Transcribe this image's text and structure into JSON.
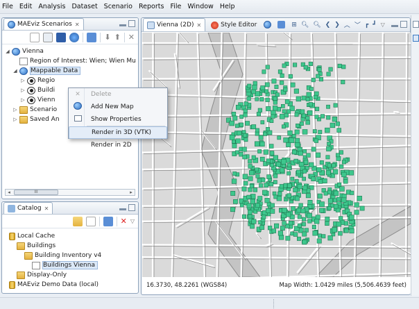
{
  "menu": [
    "File",
    "Edit",
    "Analysis",
    "Dataset",
    "Scenario",
    "Reports",
    "File",
    "Window",
    "Help"
  ],
  "scenarios_panel": {
    "tab_label": "MAEviz Scenarios",
    "tree": [
      {
        "label": "Vienna",
        "icon": "globe-icon",
        "indent": 0,
        "twisty": "◢"
      },
      {
        "label": "Region of Interest: Wien; Wien Mu",
        "icon": "document-icon",
        "indent": 1,
        "twisty": ""
      },
      {
        "label": "Mappable Data",
        "icon": "globe-icon",
        "indent": 1,
        "twisty": "◢",
        "selected": true
      },
      {
        "label": "Regio",
        "icon": "eye-icon",
        "indent": 2,
        "twisty": "▷"
      },
      {
        "label": "Buildi",
        "icon": "eye-icon",
        "indent": 2,
        "twisty": "▷"
      },
      {
        "label": "Vienn",
        "icon": "eye-icon",
        "indent": 2,
        "twisty": "▷"
      },
      {
        "label": "Scenario",
        "icon": "folder-icon",
        "indent": 1,
        "twisty": "▷"
      },
      {
        "label": "Saved An",
        "icon": "folder-icon",
        "indent": 1,
        "twisty": "▷"
      }
    ],
    "scroll_thumb": "III"
  },
  "context_menu": [
    {
      "label": "Delete",
      "icon": "delete-icon",
      "disabled": true
    },
    {
      "label": "Add New Map",
      "icon": "globe-icon",
      "disabled": false
    },
    {
      "label": "Show Properties",
      "icon": "properties-icon",
      "disabled": false
    },
    {
      "label": "Render in 3D (VTK)",
      "icon": "",
      "disabled": false,
      "highlighted": true
    },
    {
      "label": "Render in 2D",
      "icon": "",
      "disabled": false
    }
  ],
  "catalog_panel": {
    "tab_label": "Catalog",
    "tree": [
      {
        "label": "Local Cache",
        "icon": "database-icon",
        "indent": 0
      },
      {
        "label": "Buildings",
        "icon": "folder-icon",
        "indent": 1
      },
      {
        "label": "Building Inventory v4",
        "icon": "folder-icon",
        "indent": 2
      },
      {
        "label": "Buildings Vienna",
        "icon": "document-icon",
        "indent": 3,
        "selected": true
      },
      {
        "label": "Display-Only",
        "icon": "folder-icon",
        "indent": 1
      },
      {
        "label": "MAEviz Demo Data (local)",
        "icon": "database-icon",
        "indent": 0
      }
    ]
  },
  "map_panel": {
    "tabs": [
      {
        "label": "Vienna (2D)",
        "closable": true
      },
      {
        "label": "Style Editor",
        "closable": false
      }
    ],
    "coordinates": "16.3730, 48.2261 (WGS84)",
    "map_width": "Map Width: 1.0429 miles (5,506.4639 feet)"
  },
  "colors": {
    "building_fill": "#3ec78d",
    "building_stroke": "#1d7a52",
    "river": "#bcbcbc",
    "street": "#ffffff"
  }
}
